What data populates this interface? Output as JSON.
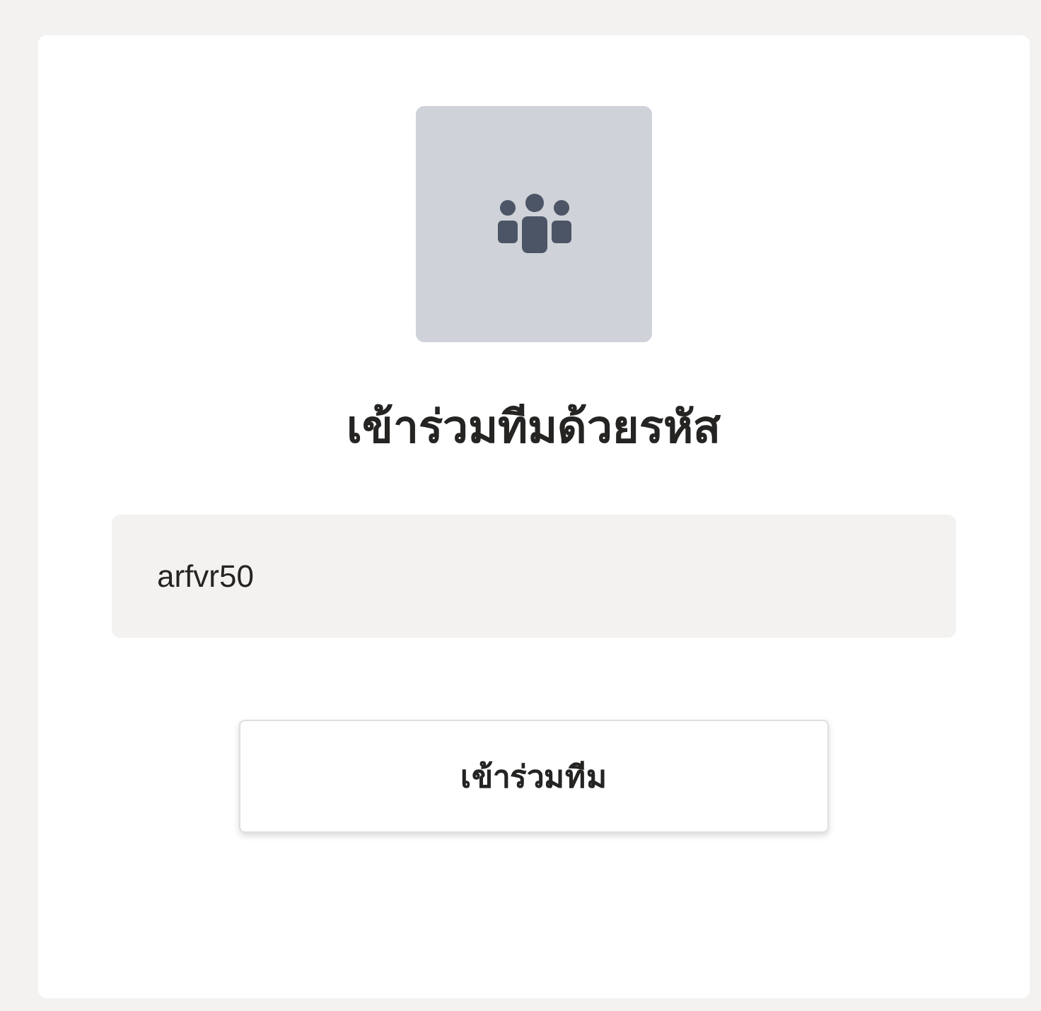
{
  "title": "เข้าร่วมทีมด้วยรหัส",
  "code_field": {
    "value": "arfvr50"
  },
  "button": {
    "label": "เข้าร่วมทีม"
  }
}
